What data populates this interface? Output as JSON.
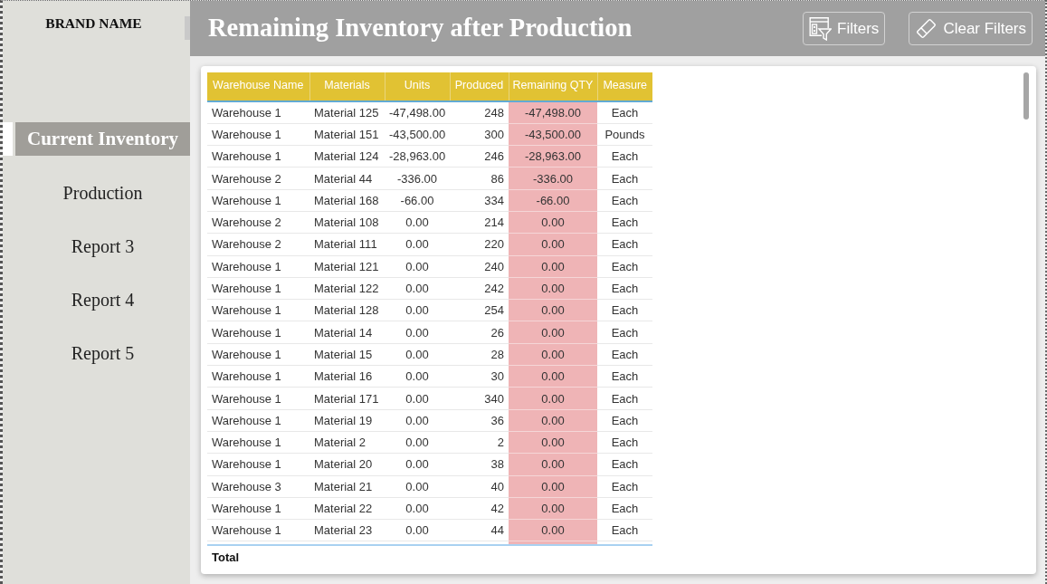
{
  "sidebar": {
    "brand": "BRAND NAME",
    "items": [
      {
        "label": "Current Inventory",
        "selected": true
      },
      {
        "label": "Production",
        "selected": false
      },
      {
        "label": "Report 3",
        "selected": false
      },
      {
        "label": "Report 4",
        "selected": false
      },
      {
        "label": "Report 5",
        "selected": false
      }
    ]
  },
  "header": {
    "title": "Remaining Inventory after Production",
    "buttons": [
      {
        "kind": "filters",
        "label": "Filters"
      },
      {
        "kind": "clear",
        "label": "Clear Filters"
      }
    ]
  },
  "table": {
    "columns": [
      {
        "label": "Warehouse Name",
        "highlighted": false
      },
      {
        "label": "Materials",
        "highlighted": false
      },
      {
        "label": "Units",
        "highlighted": false
      },
      {
        "label": "Produced",
        "highlighted": false
      },
      {
        "label": "Remaining QTY",
        "highlighted": true
      },
      {
        "label": "Measure",
        "highlighted": false
      }
    ],
    "rows": [
      [
        "Warehouse 1",
        "Material 125",
        "-47,498.00",
        "248",
        "-47,498.00",
        "Each"
      ],
      [
        "Warehouse 1",
        "Material 151",
        "-43,500.00",
        "300",
        "-43,500.00",
        "Pounds"
      ],
      [
        "Warehouse 1",
        "Material 124",
        "-28,963.00",
        "246",
        "-28,963.00",
        "Each"
      ],
      [
        "Warehouse 2",
        "Material 44",
        "-336.00",
        "86",
        "-336.00",
        "Each"
      ],
      [
        "Warehouse 1",
        "Material 168",
        "-66.00",
        "334",
        "-66.00",
        "Each"
      ],
      [
        "Warehouse 2",
        "Material 108",
        "0.00",
        "214",
        "0.00",
        "Each"
      ],
      [
        "Warehouse 2",
        "Material 111",
        "0.00",
        "220",
        "0.00",
        "Each"
      ],
      [
        "Warehouse 1",
        "Material 121",
        "0.00",
        "240",
        "0.00",
        "Each"
      ],
      [
        "Warehouse 1",
        "Material 122",
        "0.00",
        "242",
        "0.00",
        "Each"
      ],
      [
        "Warehouse 1",
        "Material 128",
        "0.00",
        "254",
        "0.00",
        "Each"
      ],
      [
        "Warehouse 1",
        "Material 14",
        "0.00",
        "26",
        "0.00",
        "Each"
      ],
      [
        "Warehouse 1",
        "Material 15",
        "0.00",
        "28",
        "0.00",
        "Each"
      ],
      [
        "Warehouse 1",
        "Material 16",
        "0.00",
        "30",
        "0.00",
        "Each"
      ],
      [
        "Warehouse 1",
        "Material 171",
        "0.00",
        "340",
        "0.00",
        "Each"
      ],
      [
        "Warehouse 1",
        "Material 19",
        "0.00",
        "36",
        "0.00",
        "Each"
      ],
      [
        "Warehouse 1",
        "Material 2",
        "0.00",
        "2",
        "0.00",
        "Each"
      ],
      [
        "Warehouse 1",
        "Material 20",
        "0.00",
        "38",
        "0.00",
        "Each"
      ],
      [
        "Warehouse 3",
        "Material 21",
        "0.00",
        "40",
        "0.00",
        "Each"
      ],
      [
        "Warehouse 1",
        "Material 22",
        "0.00",
        "42",
        "0.00",
        "Each"
      ],
      [
        "Warehouse 1",
        "Material 23",
        "0.00",
        "44",
        "0.00",
        "Each"
      ]
    ],
    "total": {
      "label": "Total"
    }
  }
}
